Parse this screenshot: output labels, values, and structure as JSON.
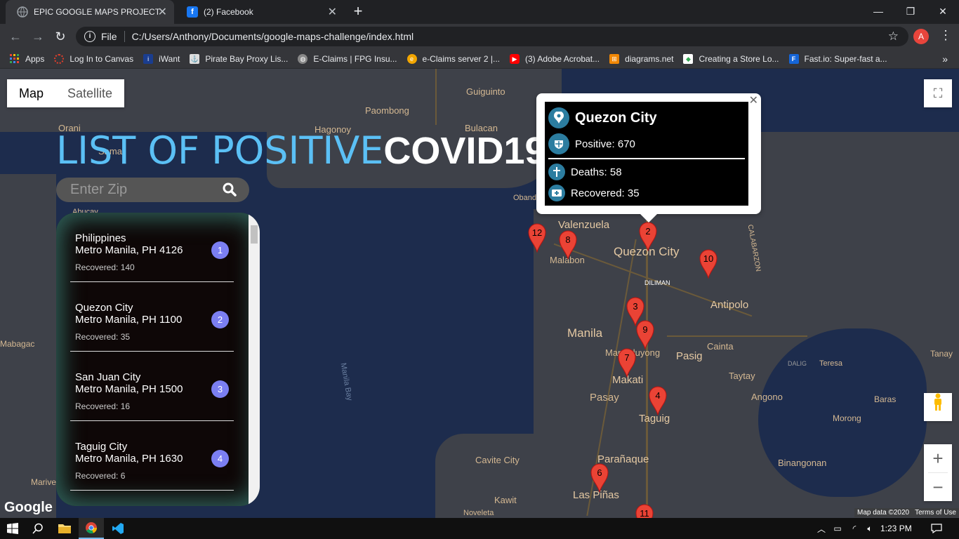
{
  "browser": {
    "tabs": [
      {
        "title": "EPIC GOOGLE MAPS PROJECT",
        "active": true,
        "icon": "globe-icon"
      },
      {
        "title": "(2) Facebook",
        "active": false,
        "icon": "facebook-icon"
      }
    ],
    "address": {
      "scheme_label": "File",
      "url": "C:/Users/Anthony/Documents/google-maps-challenge/index.html"
    },
    "profile_initial": "A",
    "bookmarks": [
      {
        "label": "Apps",
        "icon": "apps-icon",
        "color": "#ea4335"
      },
      {
        "label": "Log In to Canvas",
        "icon": "canvas-icon",
        "color": "#e13f2b"
      },
      {
        "label": "iWant",
        "icon": "iwant-icon",
        "color": "#1a3d8f"
      },
      {
        "label": "Pirate Bay Proxy Lis...",
        "icon": "pirate-icon",
        "color": "#666666"
      },
      {
        "label": "E-Claims | FPG Insu...",
        "icon": "globe-icon",
        "color": "#888888"
      },
      {
        "label": "e-Claims server 2 |...",
        "icon": "eclaims-icon",
        "color": "#f2a600"
      },
      {
        "label": "(3) Adobe Acrobat...",
        "icon": "youtube-icon",
        "color": "#ff0000"
      },
      {
        "label": "diagrams.net",
        "icon": "diagrams-icon",
        "color": "#f08705"
      },
      {
        "label": "Creating a Store Lo...",
        "icon": "store-icon",
        "color": "#ffffff"
      },
      {
        "label": "Fast.io: Super-fast a...",
        "icon": "fastio-icon",
        "color": "#1565d8"
      }
    ]
  },
  "map": {
    "type_control": {
      "map": "Map",
      "satellite": "Satellite"
    },
    "google_logo": "Google",
    "attribution": {
      "data": "Map data ©2020",
      "terms": "Terms of Use"
    },
    "labels": [
      "Guiguinto",
      "Paombong",
      "Hagonoy",
      "Bulacan",
      "Orani",
      "Samal",
      "Abucay",
      "Valenzuela",
      "Malabon",
      "Quezon City",
      "DILIMAN",
      "Antipolo",
      "Manila",
      "Mandaluyong",
      "Pasig",
      "Cainta",
      "Makati",
      "Pasay",
      "Taguig",
      "Taytay",
      "Angono",
      "Baras",
      "Tanay",
      "Teresa",
      "DALIG",
      "Morong",
      "Binangonan",
      "Cavite City",
      "Parañaque",
      "Las Piñas",
      "Kawit",
      "Noveleta",
      "Mariveles",
      "Manila Bay",
      "Obando",
      "CALABARZON",
      "Mabagac"
    ]
  },
  "header": {
    "title_part1": "LIST OF POSITIVE",
    "title_part2": "COVID19"
  },
  "search": {
    "placeholder": "Enter Zip"
  },
  "stores": [
    {
      "city": "Philippines",
      "address": "Metro Manila, PH 4126",
      "recovered": "Recovered: 140",
      "index": "1"
    },
    {
      "city": "Quezon City",
      "address": "Metro Manila, PH 1100",
      "recovered": "Recovered: 35",
      "index": "2"
    },
    {
      "city": "San Juan City",
      "address": "Metro Manila, PH 1500",
      "recovered": "Recovered: 16",
      "index": "3"
    },
    {
      "city": "Taguig City",
      "address": "Metro Manila, PH 1630",
      "recovered": "Recovered: 6",
      "index": "4"
    }
  ],
  "markers": [
    "12",
    "8",
    "2",
    "10",
    "3",
    "9",
    "7",
    "4",
    "6",
    "11"
  ],
  "infowindow": {
    "title": "Quezon City",
    "positive": "Positive: 670",
    "deaths": "Deaths: 58",
    "recovered": "Recovered: 35"
  },
  "taskbar": {
    "time": "1:23 PM"
  },
  "colors": {
    "accent_blue": "#5bc0f5",
    "marker_red": "#ea4335",
    "badge_purple": "#7b7ff2"
  }
}
